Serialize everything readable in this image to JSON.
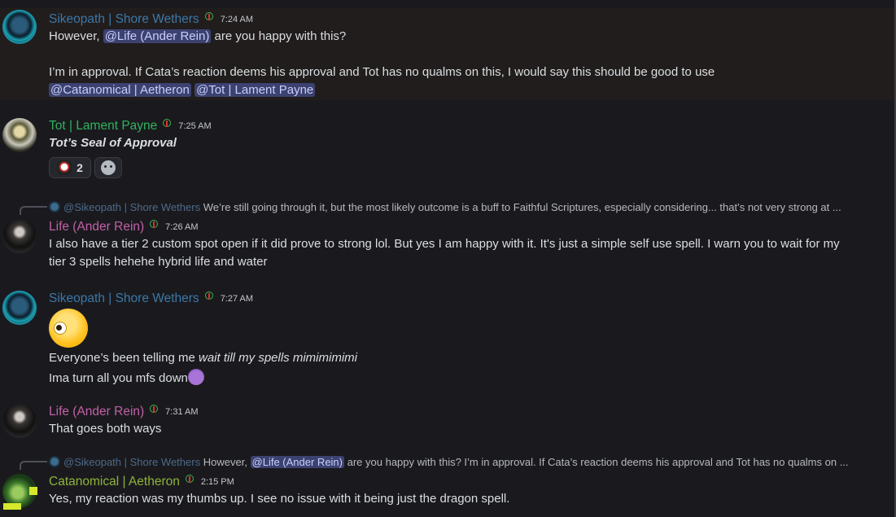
{
  "messages": {
    "m1": {
      "author": "Sikeopath | Shore Wethers",
      "time": "7:24 AM",
      "line1_pre": "However, ",
      "line1_mention": "@Life (Ander Rein)",
      "line1_post": " are you happy with this?",
      "line2": "I’m in approval. If Cata’s reaction deems his approval and Tot has no qualms on this, I would say this should be good to use",
      "mention_a": "@Catanomical | Aetheron",
      "mention_b": "@Tot | Lament Payne"
    },
    "m2": {
      "author": "Tot | Lament Payne",
      "time": "7:25 AM",
      "text": "Tot’s Seal of Approval",
      "reaction_count": "2"
    },
    "m3": {
      "reply_author": "@Sikeopath | Shore Wethers",
      "reply_text": "We’re still going through it, but the most likely outcome is a buff to Faithful Scriptures, especially considering... that’s not very strong at ...",
      "author": "Life (Ander Rein)",
      "time": "7:26 AM",
      "line1": "I also have a tier 2 custom spot open if it did prove to strong lol. But yes I am happy with it. It's just a simple self use spell. I warn you to wait for my",
      "line2": "tier 3 spells hehehe hybrid life and water"
    },
    "m4": {
      "author": "Sikeopath | Shore Wethers",
      "time": "7:27 AM",
      "line1_pre": "Everyone’s been telling me ",
      "line1_italic": "wait till my spells mimimimimi",
      "line2": "Ima turn all you mfs down"
    },
    "m5": {
      "author": "Life (Ander Rein)",
      "time": "7:31 AM",
      "text": "That goes both ways"
    },
    "m6": {
      "reply_author": "@Sikeopath | Shore Wethers",
      "reply_pre": "However, ",
      "reply_mention": "@Life (Ander Rein)",
      "reply_post": " are you happy with this?   I’m in approval. If Cata’s reaction deems his approval and Tot has no qualms on ...",
      "author": "Catanomical | Aetheron",
      "time": "2:15 PM",
      "text": "Yes, my reaction was my thumbs up. I see no issue with it being just the dragon spell."
    }
  },
  "colors": {
    "background": "#1a1a1e",
    "highlight": "#211d1d",
    "mention_bg": "#3c4270",
    "sike": "#3b78a8",
    "tot": "#2fb35e",
    "life": "#c260a6",
    "cata": "#8fb43b"
  }
}
